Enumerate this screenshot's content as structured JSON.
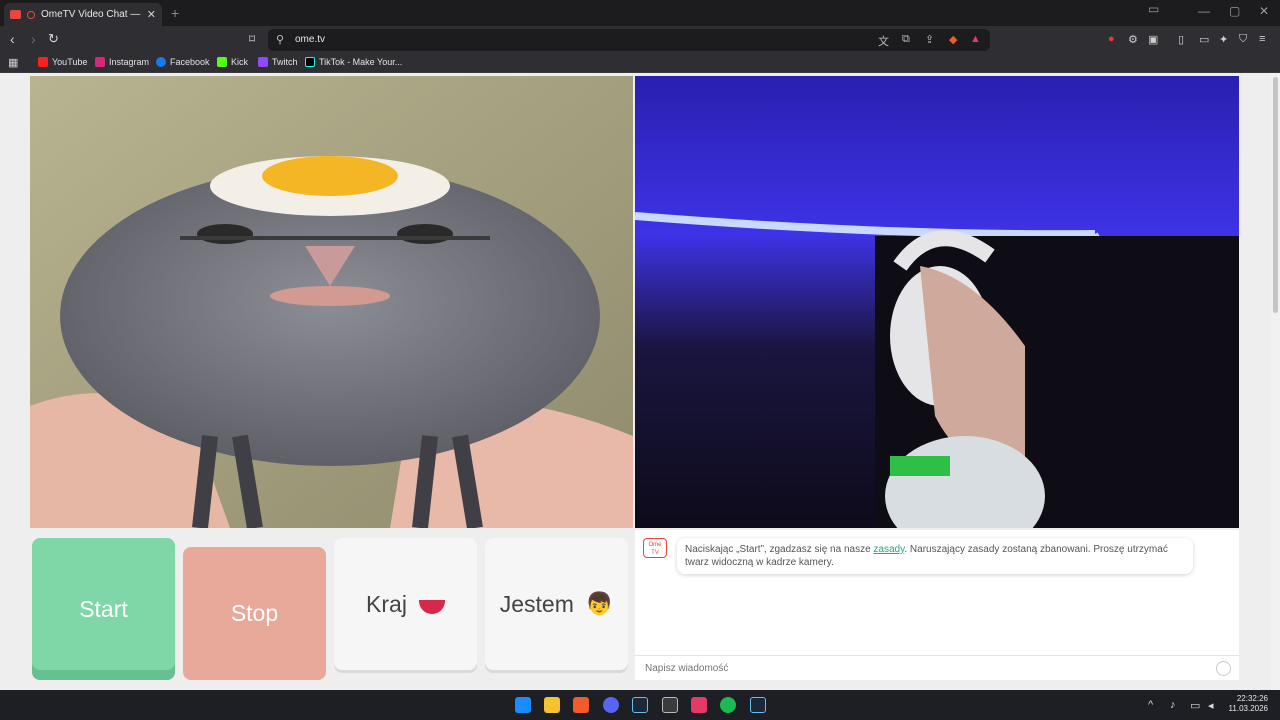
{
  "browser": {
    "tab_title": "OmeTV Video Chat — Omegl",
    "tab_close": "✕",
    "new_tab": "+",
    "url": "ome.tv",
    "bookmarks": [
      "YouTube",
      "Instagram",
      "Facebook",
      "Kick",
      "Twitch",
      "TikTok - Make Your..."
    ]
  },
  "main": {
    "buttons": {
      "start": "Start",
      "stop": "Stop",
      "country": "Kraj",
      "gender": "Jestem"
    },
    "chat": {
      "logo_text": "Ome TV",
      "rules_text_before": "Naciskając „Start”, zgadzasz się na nasze ",
      "rules_link": "zasady",
      "rules_text_after": ". Naruszający zasady zostaną zbanowani. Proszę utrzymać twarz widoczną w kadrze kamery.",
      "input_placeholder": "Napisz wiadomość"
    }
  },
  "taskbar": {
    "time": "22:32:26",
    "date": "11.03.2026"
  },
  "colors": {
    "start": "#7fd7a7",
    "stop": "#e8a99a",
    "link": "#2aa57a",
    "brand": "#e9473c"
  }
}
